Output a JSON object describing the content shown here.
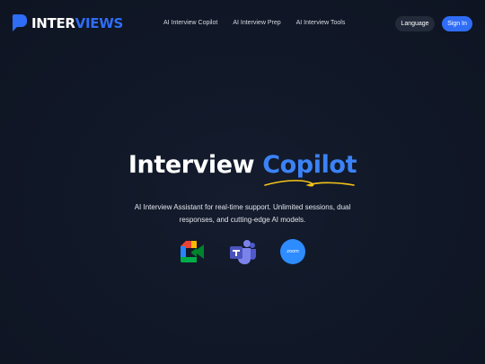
{
  "brand": {
    "name_main": "INTER",
    "name_accent": "VIEWS",
    "logo_icon": "chat-bubble-icon",
    "accent_color": "#2f6df6"
  },
  "nav": {
    "items": [
      {
        "label": "AI Interview Copilot"
      },
      {
        "label": "AI Interview Prep"
      },
      {
        "label": "AI Interview Tools"
      }
    ]
  },
  "header_actions": {
    "language_label": "Language",
    "signin_label": "Sign In"
  },
  "hero": {
    "title_main": "Interview ",
    "title_accent": "Copilot",
    "subtitle": "AI Interview Assistant for real-time support. Unlimited sessions, dual responses, and cutting-edge AI models."
  },
  "integrations": [
    {
      "icon": "google-meet-icon"
    },
    {
      "icon": "microsoft-teams-icon"
    },
    {
      "icon": "zoom-icon",
      "label": "zoom"
    }
  ],
  "colors": {
    "background": "#111827",
    "accent_blue": "#3b82f6",
    "underline_yellow": "#f5c518"
  }
}
